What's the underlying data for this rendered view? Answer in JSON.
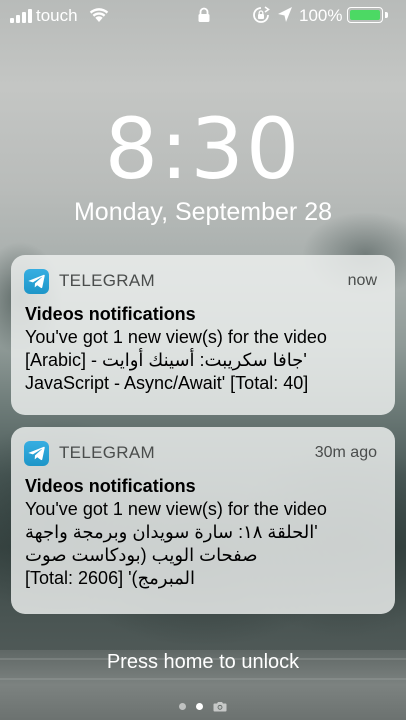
{
  "status_bar": {
    "carrier": "touch",
    "battery_percent_label": "100%",
    "battery_level": 1.0,
    "battery_color": "#4cd964",
    "icons": [
      "signal-icon",
      "wifi-icon",
      "lock-icon",
      "rotation-lock-icon",
      "location-arrow-icon",
      "battery-icon"
    ]
  },
  "lock_screen": {
    "time": "8:30",
    "date": "Monday, September 28",
    "unlock_hint": "Press home to unlock"
  },
  "notifications": [
    {
      "app_name": "TELEGRAM",
      "time": "now",
      "title": "Videos notifications",
      "lines": [
        "You've got 1 new view(s) for the video",
        "'جافا سكريبت: أسينك أوايت - [Arabic]",
        "JavaScript - Async/Await' [Total: 40]"
      ],
      "icon": "telegram-icon",
      "accent_color": "#2ca5e0"
    },
    {
      "app_name": "TELEGRAM",
      "time": "30m ago",
      "title": "Videos notifications",
      "lines": [
        "You've got 1 new view(s) for the video",
        "'الحلقة ١٨: سارة سويدان وبرمجة واجهة",
        "صفحات الويب (بودكاست صوت",
        "المبرمج)' [Total: 2606]"
      ],
      "icon": "telegram-icon",
      "accent_color": "#2ca5e0"
    }
  ],
  "page_indicator": {
    "pages": 3,
    "active_index": 1,
    "last_icon": "camera-icon"
  }
}
